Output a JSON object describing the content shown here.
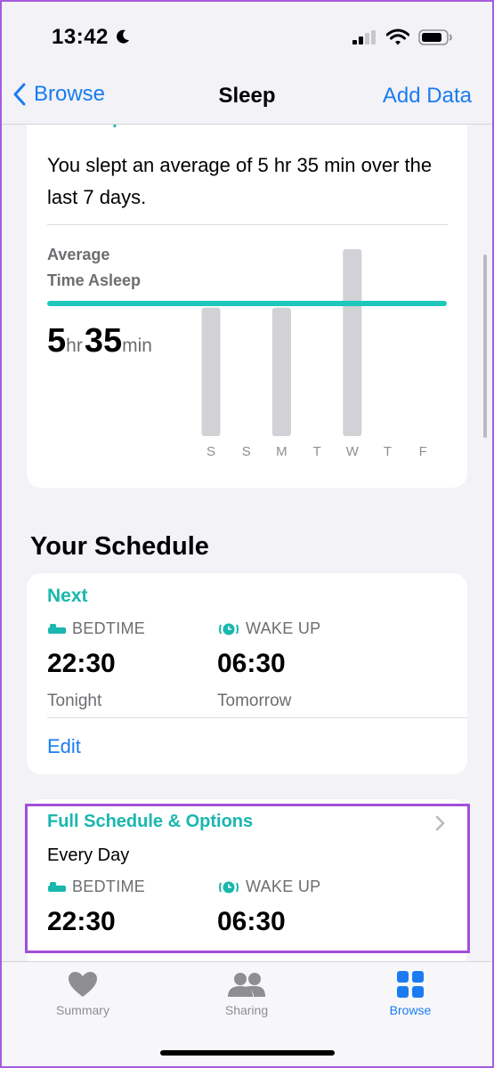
{
  "status_bar": {
    "time": "13:42"
  },
  "nav": {
    "back_label": "Browse",
    "title": "Sleep",
    "action_label": "Add Data"
  },
  "sleep_card": {
    "header": "Sleep",
    "description": "You slept an average of 5 hr 35 min over the last 7 days.",
    "avg_label_line1": "Average",
    "avg_label_line2": "Time Asleep",
    "avg_hours": "5",
    "avg_hours_unit": "hr",
    "avg_minutes": "35",
    "avg_minutes_unit": "min"
  },
  "chart_data": {
    "type": "bar",
    "categories": [
      "S",
      "S",
      "M",
      "T",
      "W",
      "T",
      "F"
    ],
    "values": [
      5.5,
      0,
      5.5,
      0,
      8.0,
      0,
      0
    ],
    "average": 5.58,
    "colors": {
      "bar": "#d1d1d6",
      "average_line": "#1ec7bb"
    }
  },
  "schedule": {
    "section_title": "Your Schedule",
    "next_label": "Next",
    "bedtime_label": "BEDTIME",
    "bedtime_time": "22:30",
    "bedtime_sub": "Tonight",
    "wakeup_label": "WAKE UP",
    "wakeup_time": "06:30",
    "wakeup_sub": "Tomorrow",
    "edit_label": "Edit"
  },
  "full_schedule": {
    "title": "Full Schedule & Options",
    "days": "Every Day",
    "bedtime_label": "BEDTIME",
    "bedtime_time": "22:30",
    "wakeup_label": "WAKE UP",
    "wakeup_time": "06:30"
  },
  "tabs": [
    {
      "label": "Summary",
      "icon": "heart-icon"
    },
    {
      "label": "Sharing",
      "icon": "people-icon"
    },
    {
      "label": "Browse",
      "icon": "grid-icon",
      "active": true
    }
  ],
  "colors": {
    "accent": "#1a7cf0",
    "teal": "#19b7ae",
    "highlight": "#a24fd8"
  }
}
